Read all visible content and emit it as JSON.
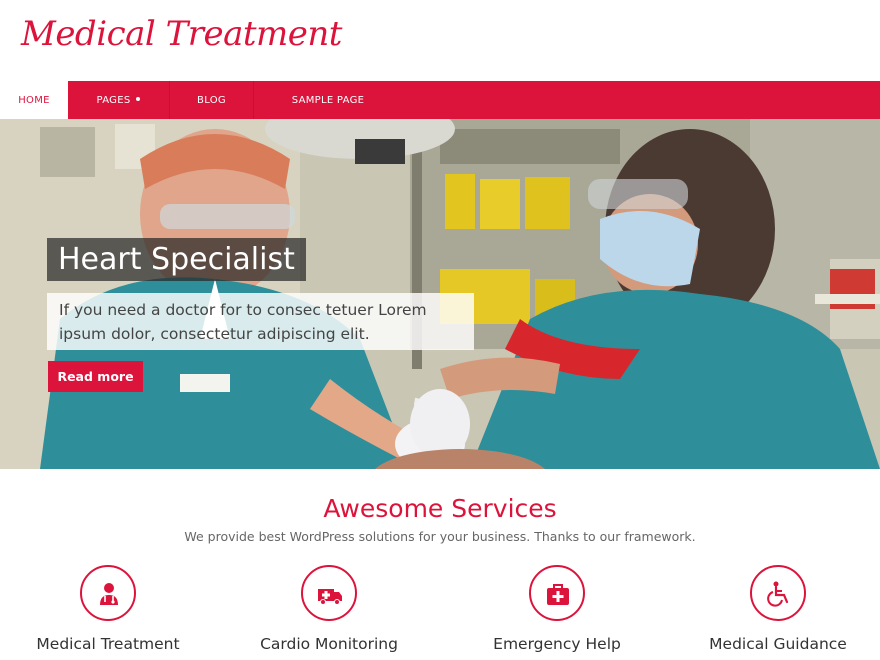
{
  "site": {
    "logo": "Medical Treatment"
  },
  "nav": {
    "items": [
      {
        "label": "HOME",
        "active": true
      },
      {
        "label": "PAGES",
        "has_submenu": true
      },
      {
        "label": "BLOG"
      },
      {
        "label": "SAMPLE PAGE"
      }
    ]
  },
  "hero": {
    "title": "Heart Specialist",
    "text": "If you need a doctor for to consec tetuer Lorem ipsum dolor, consectetur adipiscing elit.",
    "button_label": "Read more",
    "image_description": "photo-two-medical-staff-in-teal-scrubs"
  },
  "services": {
    "title": "Awesome Services",
    "subtitle": "We provide best WordPress solutions for your business. Thanks to our framework.",
    "items": [
      {
        "label": "Medical Treatment",
        "icon": "doctor-icon"
      },
      {
        "label": "Cardio Monitoring",
        "icon": "ambulance-icon"
      },
      {
        "label": "Emergency Help",
        "icon": "medical-kit-icon"
      },
      {
        "label": "Medical Guidance",
        "icon": "wheelchair-icon"
      }
    ]
  },
  "colors": {
    "accent": "#dc143c",
    "nav_bg": "#dc143c",
    "scrubs": "#2e8f9a"
  }
}
